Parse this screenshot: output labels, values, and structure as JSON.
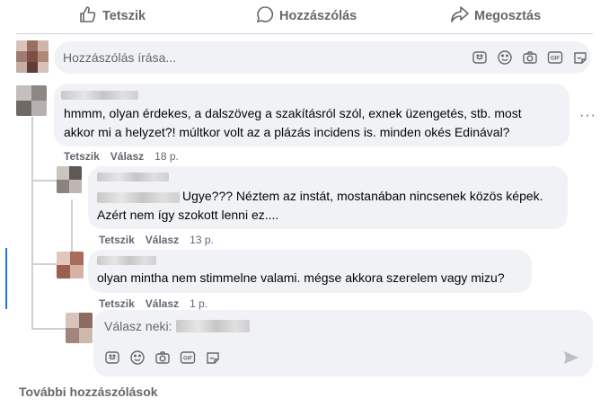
{
  "actions": {
    "like": "Tetszik",
    "comment": "Hozzászólás",
    "share": "Megosztás"
  },
  "composer": {
    "placeholder": "Hozzászólás írása..."
  },
  "comments": [
    {
      "line1": "hmmm, olyan érdekes, a dalszöveg a szakításról szól, exnek üzengetés, stb. most",
      "line2": "akkor mi a helyzet?! múltkor volt az a plázás incidens is. minden okés Edinával?",
      "like": "Tetszik",
      "reply": "Válasz",
      "time": "18 p."
    },
    {
      "line1": "Ugye??? Néztem az instát, mostanában nincsenek közös képek.",
      "line2": "Azért nem így szokott lenni ez....",
      "like": "Tetszik",
      "reply": "Válasz",
      "time": "13 p."
    },
    {
      "line1": "olyan mintha nem stimmelne valami. mégse akkora szerelem vagy mizu?",
      "like": "Tetszik",
      "reply": "Válasz",
      "time": "1 p."
    }
  ],
  "reply_composer": {
    "label": "Válasz neki:"
  },
  "more_comments": "További hozzászólások",
  "icons": [
    "like-icon",
    "comment-icon",
    "share-icon",
    "sticker-icon",
    "emoji-icon",
    "camera-icon",
    "gif-icon",
    "avatar-sticker-icon",
    "send-icon",
    "more-options-icon"
  ],
  "colors": {
    "bubble": "#f0f2f5",
    "secondary_text": "#65676b",
    "focus": "#1b74e4"
  }
}
